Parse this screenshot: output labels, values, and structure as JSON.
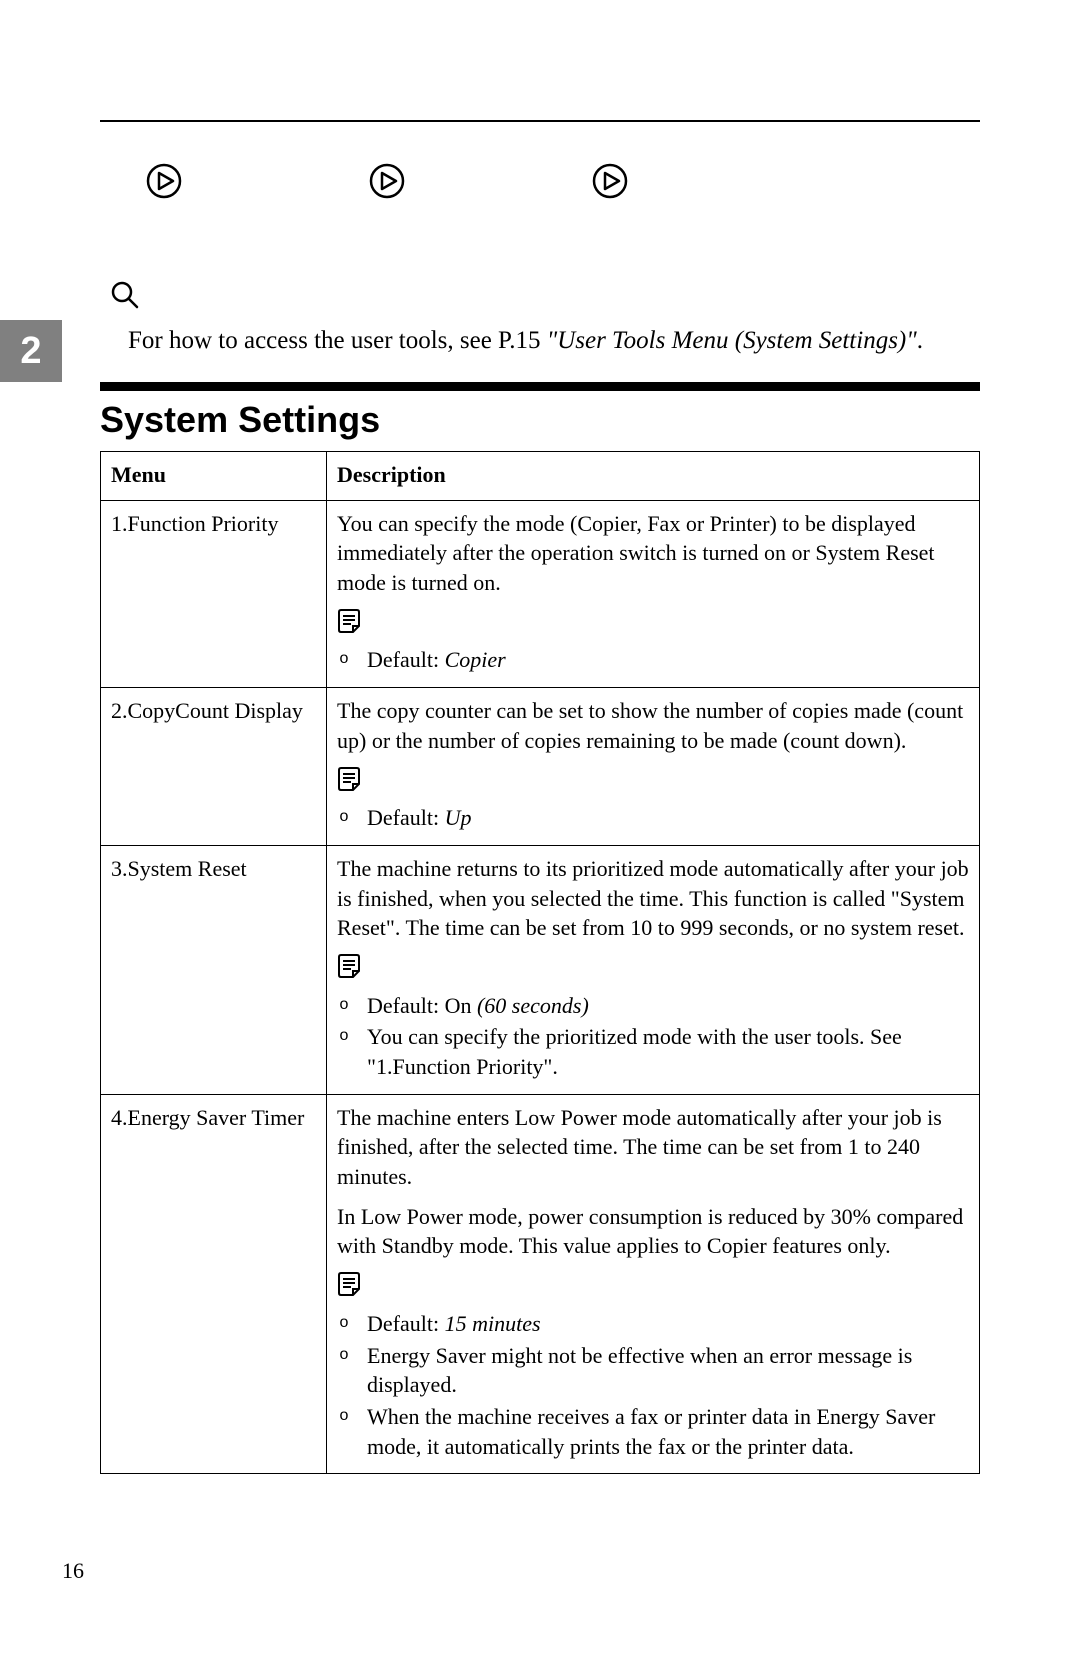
{
  "chapter_tab": "2",
  "page_number": "16",
  "reference": {
    "prefix": "For how to access the user tools, see P.15 ",
    "italic": "\"User Tools Menu (System Settings)\"",
    "suffix": "."
  },
  "section_title": "System Settings",
  "table": {
    "head": {
      "menu": "Menu",
      "desc": "Description"
    },
    "rows": [
      {
        "menu": "1.Function Priority",
        "paragraphs": [
          "You can specify the mode (Copier, Fax or Printer) to be displayed immediately after the operation switch is turned on or System Reset mode is turned on."
        ],
        "bullets": [
          {
            "plain": "Default: ",
            "italic": "Copier"
          }
        ]
      },
      {
        "menu": "2.CopyCount Display",
        "paragraphs": [
          "The copy counter can be set to show the number of copies made (count up) or the number of copies remaining to be made (count down)."
        ],
        "bullets": [
          {
            "plain": "Default: ",
            "italic": "Up"
          }
        ]
      },
      {
        "menu": "3.System Reset",
        "paragraphs": [
          "The machine returns to its prioritized mode automatically after your job is finished, when you selected the time. This function is called \"System Reset\". The time can be set from 10 to 999 seconds, or no system reset."
        ],
        "bullets": [
          {
            "plain": "Default: On ",
            "italic": "(60 seconds)"
          },
          {
            "plain": "You can specify the prioritized mode with the user tools. See \"1.Function Priority\"."
          }
        ]
      },
      {
        "menu": "4.Energy Saver Timer",
        "paragraphs": [
          "The machine enters Low Power mode automatically after your job is finished, after the selected time. The time can be set from 1 to 240 minutes.",
          "In Low Power mode, power consumption is reduced by 30% compared with Standby mode. This value applies to Copier features only."
        ],
        "bullets": [
          {
            "plain": "Default: ",
            "italic": "15 minutes"
          },
          {
            "plain": "Energy Saver might not be effective when an error message is displayed."
          },
          {
            "plain": "When the machine receives a fax or printer data in Energy Saver mode, it automatically prints the fax or the printer data."
          }
        ]
      }
    ]
  }
}
